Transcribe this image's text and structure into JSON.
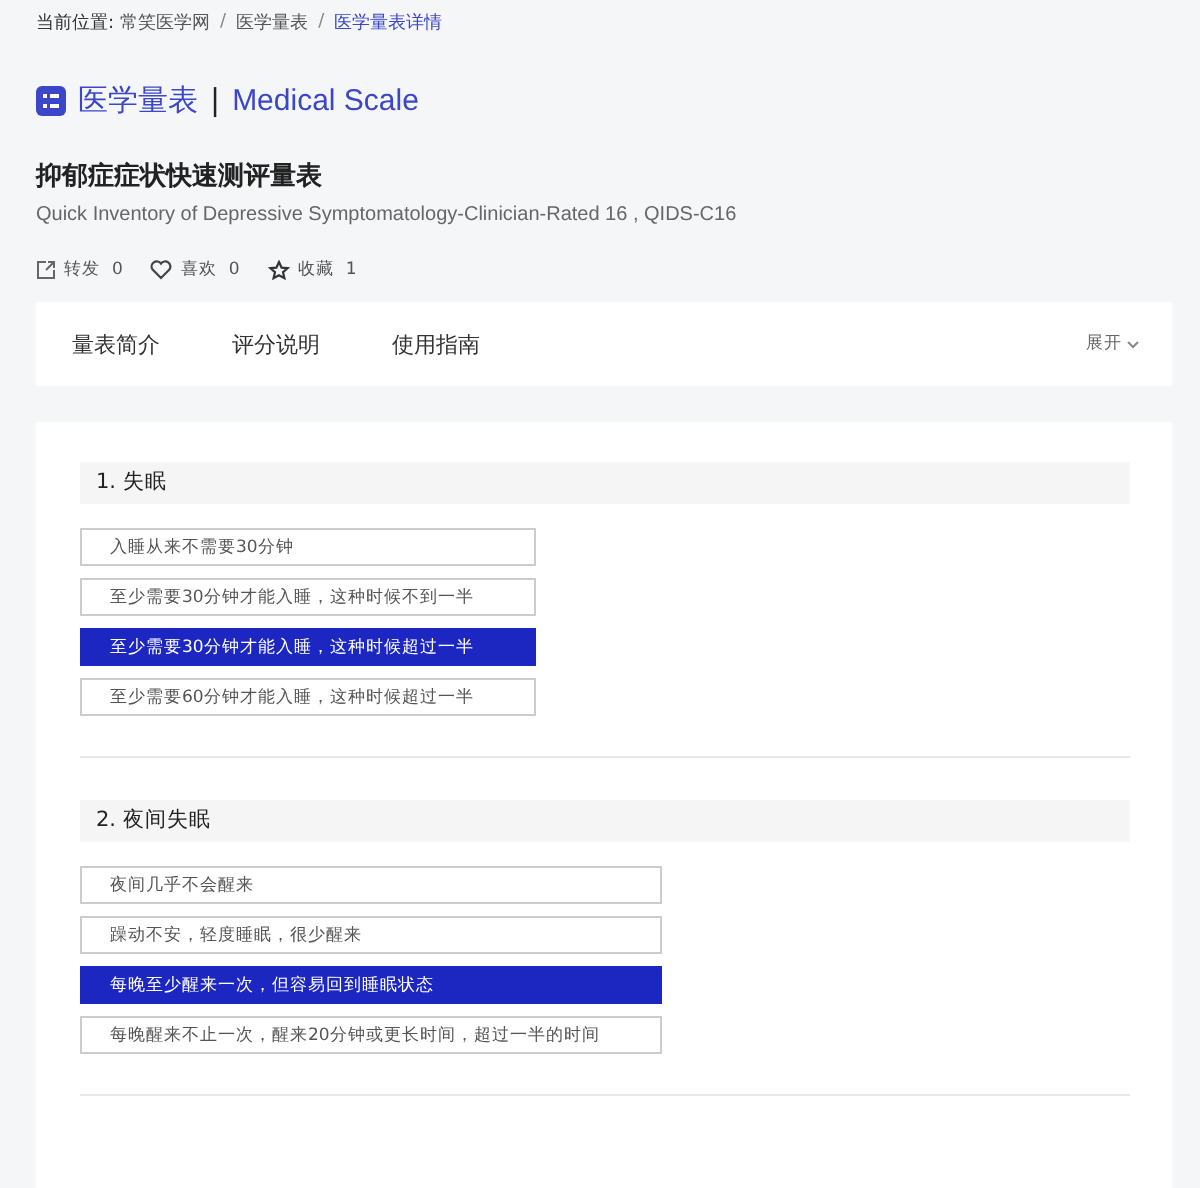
{
  "breadcrumb": {
    "label": "当前位置:",
    "items": [
      {
        "text": "常笑医学网",
        "selected": false
      },
      {
        "text": "医学量表",
        "selected": false
      },
      {
        "text": "医学量表详情",
        "selected": true
      }
    ],
    "separator": "/"
  },
  "section_title": {
    "zh": "医学量表",
    "divider": "|",
    "en": "Medical Scale"
  },
  "title": "抑郁症症状快速测评量表",
  "subtitle": "Quick Inventory of Depressive Symptomatology-Clinician-Rated 16 , QIDS-C16",
  "actions": [
    {
      "kind": "share",
      "label": "转发",
      "count": "0"
    },
    {
      "kind": "like",
      "label": "喜欢",
      "count": "0"
    },
    {
      "kind": "favorite",
      "label": "收藏",
      "count": "1"
    }
  ],
  "tabs": [
    {
      "label": "量表简介"
    },
    {
      "label": "评分说明"
    },
    {
      "label": "使用指南"
    }
  ],
  "expand": "展开",
  "questions": [
    {
      "title": "1. 失眠",
      "options": [
        {
          "text": "入睡从来不需要30分钟",
          "selected": false
        },
        {
          "text": "至少需要30分钟才能入睡，这种时候不到一半",
          "selected": false
        },
        {
          "text": "至少需要30分钟才能入睡，这种时候超过一半",
          "selected": true
        },
        {
          "text": "至少需要60分钟才能入睡，这种时候超过一半",
          "selected": false
        }
      ]
    },
    {
      "title": "2. 夜间失眠",
      "options": [
        {
          "text": "夜间几乎不会醒来",
          "selected": false
        },
        {
          "text": "躁动不安，轻度睡眠，很少醒来",
          "selected": false
        },
        {
          "text": "每晚至少醒来一次，但容易回到睡眠状态",
          "selected": true
        },
        {
          "text": "每晚醒来不止一次，醒来20分钟或更长时间，超过一半的时间",
          "selected": false
        }
      ]
    }
  ]
}
